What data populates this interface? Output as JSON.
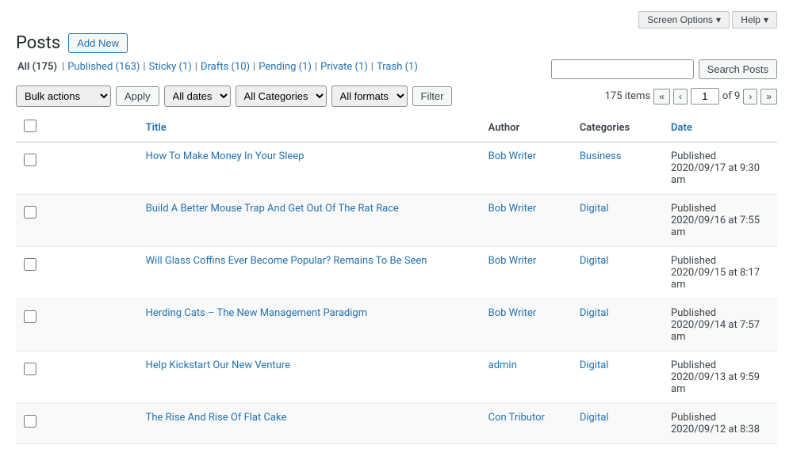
{
  "topbar": {
    "screen_options": "Screen Options",
    "screen_options_icon": "▾",
    "help": "Help",
    "help_icon": "▾"
  },
  "header": {
    "title": "Posts",
    "add_new": "Add New"
  },
  "sub_nav": {
    "items": [
      {
        "label": "All",
        "count": "175",
        "active": true
      },
      {
        "label": "Published",
        "count": "163",
        "active": false
      },
      {
        "label": "Sticky",
        "count": "1",
        "active": false
      },
      {
        "label": "Drafts",
        "count": "10",
        "active": false
      },
      {
        "label": "Pending",
        "count": "1",
        "active": false
      },
      {
        "label": "Private",
        "count": "1",
        "active": false
      },
      {
        "label": "Trash",
        "count": "1",
        "active": false
      }
    ]
  },
  "search": {
    "placeholder": "",
    "button": "Search Posts"
  },
  "filters": {
    "bulk_actions": "Bulk actions",
    "apply": "Apply",
    "all_dates": "All dates",
    "all_categories": "All Categories",
    "all_formats": "All formats",
    "filter": "Filter"
  },
  "pagination": {
    "items_count": "175 items",
    "first": "«",
    "prev": "‹",
    "current_page": "1",
    "of": "of 9",
    "next": "›",
    "last": "»"
  },
  "table": {
    "columns": {
      "title": "Title",
      "author": "Author",
      "categories": "Categories",
      "date": "Date"
    },
    "rows": [
      {
        "title": "How To Make Money In Your Sleep",
        "author": "Bob Writer",
        "categories": "Business",
        "date_status": "Published",
        "date_value": "2020/09/17 at 9:30 am"
      },
      {
        "title": "Build A Better Mouse Trap And Get Out Of The Rat Race",
        "author": "Bob Writer",
        "categories": "Digital",
        "date_status": "Published",
        "date_value": "2020/09/16 at 7:55 am"
      },
      {
        "title": "Will Glass Coffins Ever Become Popular? Remains To Be Seen",
        "author": "Bob Writer",
        "categories": "Digital",
        "date_status": "Published",
        "date_value": "2020/09/15 at 8:17 am"
      },
      {
        "title": "Herding Cats – The New Management Paradigm",
        "author": "Bob Writer",
        "categories": "Digital",
        "date_status": "Published",
        "date_value": "2020/09/14 at 7:57 am"
      },
      {
        "title": "Help Kickstart Our New Venture",
        "author": "admin",
        "categories": "Digital",
        "date_status": "Published",
        "date_value": "2020/09/13 at 9:59 am"
      },
      {
        "title": "The Rise And Rise Of Flat Cake",
        "author": "Con Tributor",
        "categories": "Digital",
        "date_status": "Published",
        "date_value": "2020/09/12 at 8:38"
      }
    ]
  }
}
